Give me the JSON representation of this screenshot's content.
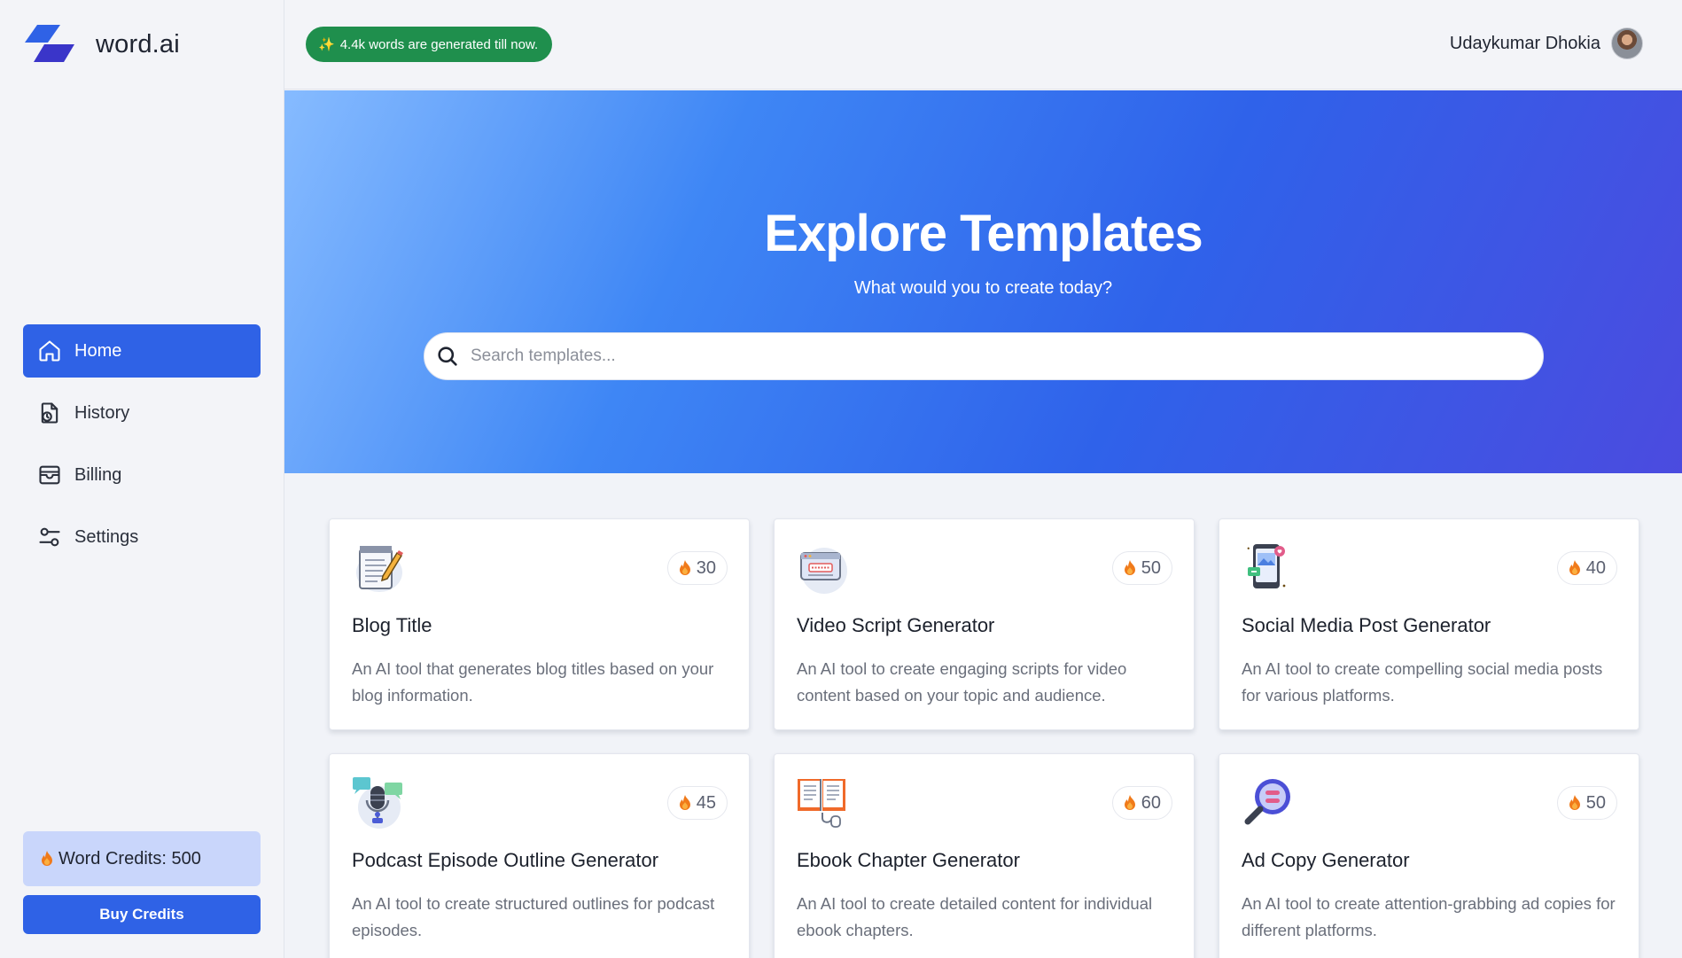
{
  "brand": {
    "name": "word.ai"
  },
  "header": {
    "badge_text": "4.4k words are generated till now.",
    "user_name": "Udaykumar Dhokia"
  },
  "sidebar": {
    "items": [
      {
        "label": "Home",
        "icon": "home-icon",
        "active": true
      },
      {
        "label": "History",
        "icon": "history-icon",
        "active": false
      },
      {
        "label": "Billing",
        "icon": "billing-icon",
        "active": false
      },
      {
        "label": "Settings",
        "icon": "settings-icon",
        "active": false
      }
    ],
    "credits_text": "Word Credits: 500",
    "buy_label": "Buy Credits"
  },
  "hero": {
    "title": "Explore Templates",
    "subtitle": "What would you to create today?",
    "search_placeholder": "Search templates..."
  },
  "templates": [
    {
      "title": "Blog Title",
      "credits": "30",
      "icon": "blog-notepad-icon",
      "description": "An AI tool that generates blog titles based on your blog information."
    },
    {
      "title": "Video Script Generator",
      "credits": "50",
      "icon": "video-script-icon",
      "description": "An AI tool to create engaging scripts for video content based on your topic and audience."
    },
    {
      "title": "Social Media Post Generator",
      "credits": "40",
      "icon": "social-media-phone-icon",
      "description": "An AI tool to create compelling social media posts for various platforms."
    },
    {
      "title": "Podcast Episode Outline Generator",
      "credits": "45",
      "icon": "podcast-microphone-icon",
      "description": "An AI tool to create structured outlines for podcast episodes."
    },
    {
      "title": "Ebook Chapter Generator",
      "credits": "60",
      "icon": "ebook-icon",
      "description": "An AI tool to create detailed content for individual ebook chapters."
    },
    {
      "title": "Ad Copy Generator",
      "credits": "50",
      "icon": "ad-magnifier-icon",
      "description": "An AI tool to create attention-grabbing ad copies for different platforms."
    }
  ],
  "colors": {
    "accent": "#2f62e6",
    "badge_green": "#1f8f4d",
    "credits_bg": "#c9d6fb",
    "flame": "#f07a1a"
  }
}
